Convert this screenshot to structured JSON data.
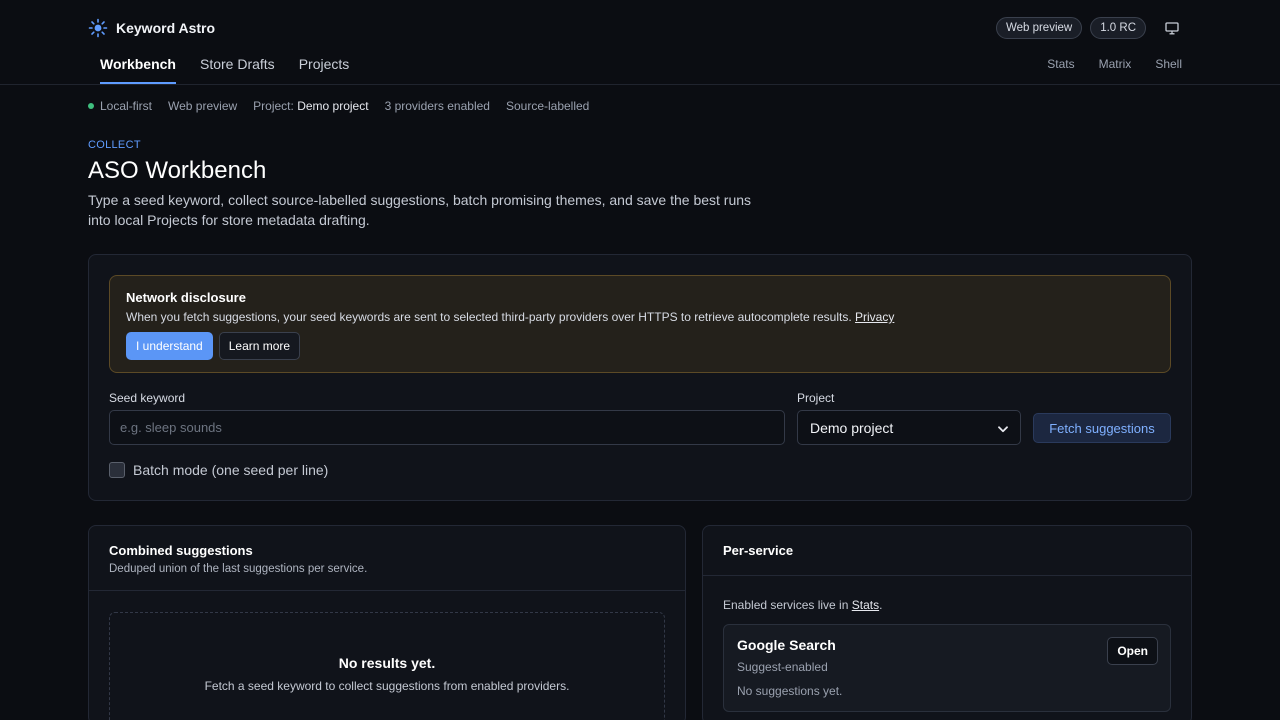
{
  "app": {
    "name": "Keyword Astro",
    "brand_icon": "sun-icon",
    "badges": [
      "Web preview",
      "1.0 RC"
    ],
    "display_icon": "monitor-icon"
  },
  "nav": {
    "tabs": [
      {
        "label": "Workbench",
        "active": true
      },
      {
        "label": "Store Drafts",
        "active": false
      },
      {
        "label": "Projects",
        "active": false
      }
    ],
    "right_links": [
      "Stats",
      "Matrix",
      "Shell"
    ]
  },
  "status": {
    "local": "Local-first",
    "mode": "Web preview",
    "project_prefix": "Project:",
    "project_name": "Demo project",
    "providers": "3 providers enabled",
    "labelled": "Source-labelled"
  },
  "intro": {
    "eyebrow": "COLLECT",
    "title": "ASO Workbench",
    "lead": "Type a seed keyword, collect source-labelled suggestions, batch promising themes, and save the best runs into local Projects for store metadata drafting."
  },
  "disclosure": {
    "title": "Network disclosure",
    "text": "When you fetch suggestions, your seed keywords are sent to selected third-party providers over HTTPS to retrieve autocomplete results.",
    "link": "Privacy",
    "accept": "I understand",
    "learn": "Learn more"
  },
  "form": {
    "seed_label": "Seed keyword",
    "seed_value": "",
    "seed_placeholder": "e.g. sleep sounds",
    "project_label": "Project",
    "project_value": "Demo project",
    "fetch": "Fetch suggestions",
    "batch_label": "Batch mode (one seed per line)",
    "batch_checked": false
  },
  "combined": {
    "title": "Combined suggestions",
    "subtitle": "Deduped union of the last suggestions per service.",
    "empty_title": "No results yet.",
    "empty_text": "Fetch a seed keyword to collect suggestions from enabled providers."
  },
  "per_service": {
    "title": "Per-service",
    "note_prefix": "Enabled services live in",
    "note_link": "Stats",
    "note_suffix": ".",
    "services": [
      {
        "name": "Google Search",
        "state": "Suggest-enabled",
        "empty": "No suggestions yet.",
        "action": "Open"
      }
    ]
  },
  "colors": {
    "accent": "#5f9cff",
    "background": "#0b0d12",
    "status_ok": "#3fbf7f",
    "warning_border": "#5c4a26"
  }
}
